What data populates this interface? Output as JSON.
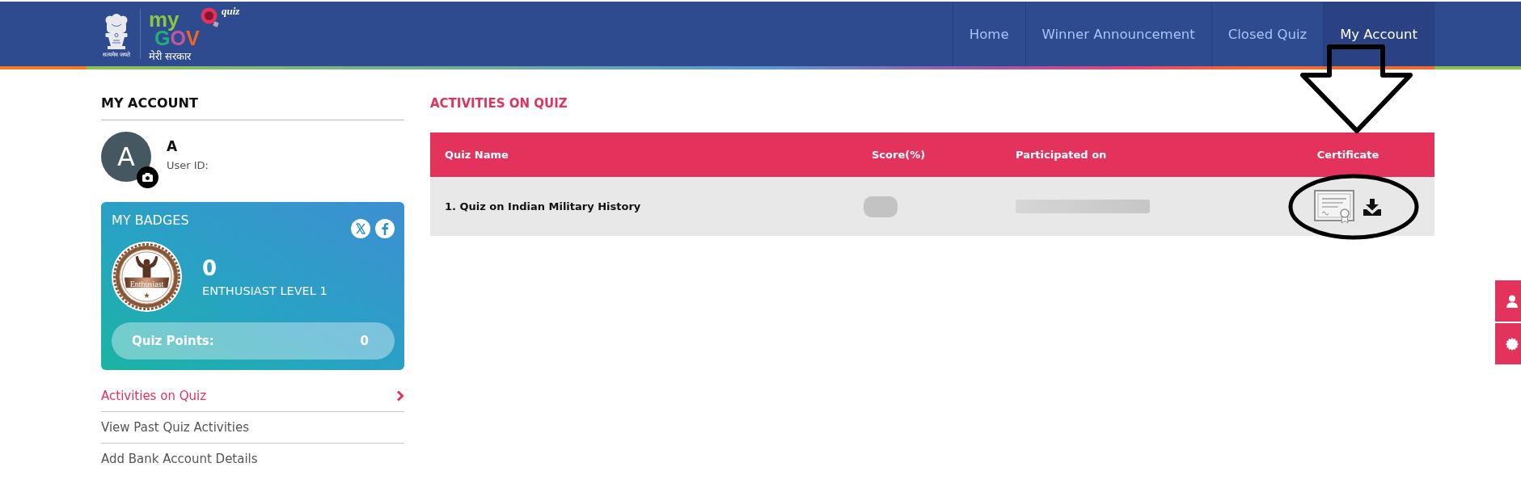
{
  "header": {
    "logo": {
      "motto": "सत्यमेव जयते",
      "brand_top": "my",
      "brand_main": "GOV",
      "badge": "quiz",
      "tagline": "मेरी सरकार"
    },
    "nav": [
      {
        "label": "Home",
        "selected": false
      },
      {
        "label": "Winner Announcement",
        "selected": false
      },
      {
        "label": "Closed Quiz",
        "selected": false
      },
      {
        "label": "My Account",
        "selected": true
      }
    ]
  },
  "sidebar": {
    "title": "MY ACCOUNT",
    "profile": {
      "avatar_letter": "A",
      "name": "A",
      "user_id_label": "User ID:"
    },
    "badges": {
      "title": "MY BADGES",
      "share": [
        {
          "kind": "x"
        },
        {
          "kind": "f"
        }
      ],
      "badge_label": "Enthusiast",
      "points": "0",
      "level": "ENTHUSIAST LEVEL 1",
      "quiz_points_label": "Quiz Points:",
      "quiz_points": "0"
    },
    "menu": [
      {
        "label": "Activities on Quiz",
        "selected": true
      },
      {
        "label": "View Past Quiz Activities",
        "selected": false
      },
      {
        "label": "Add Bank Account Details",
        "selected": false
      }
    ]
  },
  "main": {
    "title": "ACTIVITIES ON QUIZ",
    "table": {
      "columns": [
        "Quiz Name",
        "Score(%)",
        "Participated on",
        "Certificate"
      ],
      "rows": [
        {
          "quiz_name": "1. Quiz on Indian Military History",
          "score_blurred": true,
          "date_blurred": true,
          "certificate_actions": [
            {
              "kind": "certificate"
            },
            {
              "kind": "download"
            }
          ]
        }
      ]
    }
  },
  "side_buttons": [
    {
      "kind": "user"
    },
    {
      "kind": "seal"
    }
  ],
  "annotations": {
    "arrow": true,
    "ellipse": true
  }
}
